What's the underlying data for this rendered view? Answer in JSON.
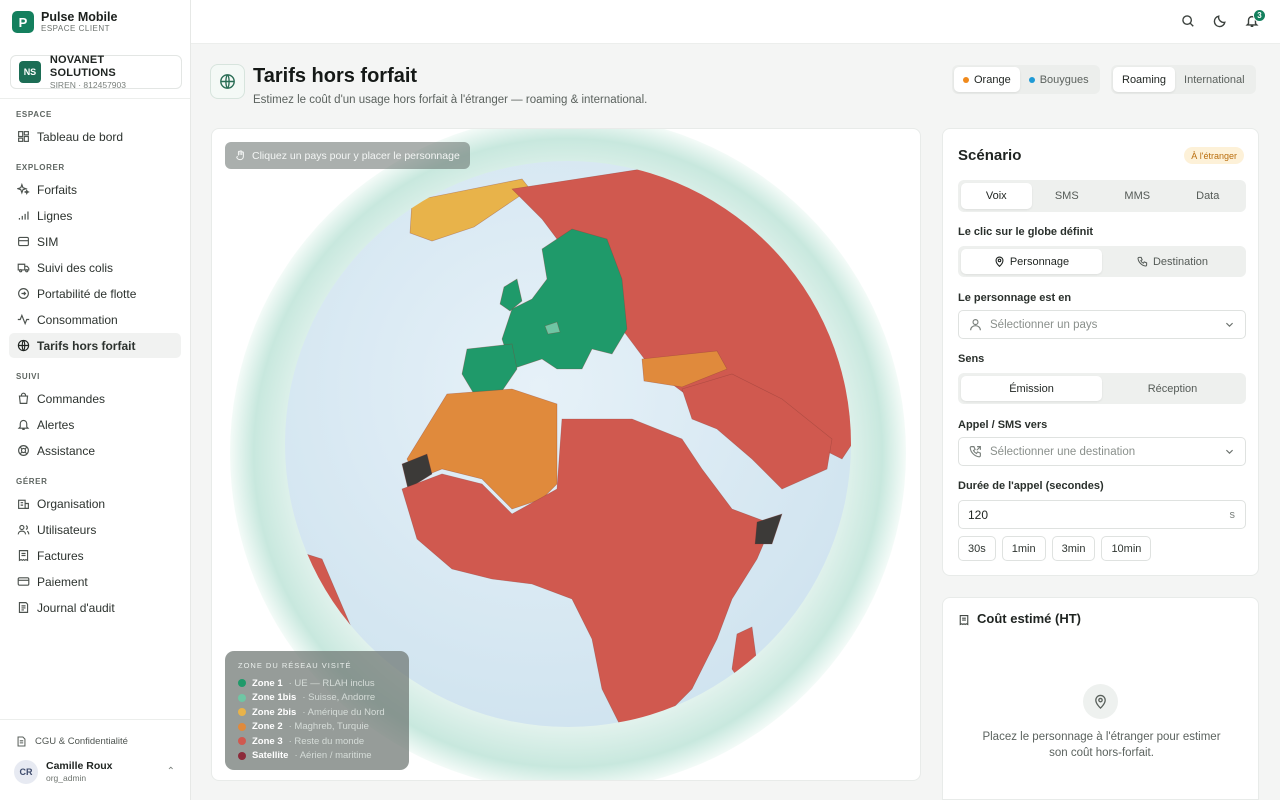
{
  "brand": {
    "logo_letter": "P",
    "name": "Pulse Mobile",
    "subtitle": "ESPACE CLIENT"
  },
  "org": {
    "initials": "NS",
    "name": "NOVANET SOLUTIONS",
    "siren": "SIREN · 812457903"
  },
  "nav": {
    "sections": [
      {
        "title": "ESPACE",
        "items": [
          {
            "label": "Tableau de bord",
            "icon": "dashboard-icon"
          }
        ]
      },
      {
        "title": "EXPLORER",
        "items": [
          {
            "label": "Forfaits",
            "icon": "sparkles-icon"
          },
          {
            "label": "Lignes",
            "icon": "signal-icon"
          },
          {
            "label": "SIM",
            "icon": "sim-card-icon"
          },
          {
            "label": "Suivi des colis",
            "icon": "truck-icon"
          },
          {
            "label": "Portabilité de flotte",
            "icon": "transfer-icon"
          },
          {
            "label": "Consommation",
            "icon": "activity-icon"
          },
          {
            "label": "Tarifs hors forfait",
            "icon": "globe-icon",
            "active": true
          }
        ]
      },
      {
        "title": "SUIVI",
        "items": [
          {
            "label": "Commandes",
            "icon": "shopping-bag-icon"
          },
          {
            "label": "Alertes",
            "icon": "bell-icon"
          },
          {
            "label": "Assistance",
            "icon": "lifebuoy-icon"
          }
        ]
      },
      {
        "title": "GÉRER",
        "items": [
          {
            "label": "Organisation",
            "icon": "building-icon"
          },
          {
            "label": "Utilisateurs",
            "icon": "users-icon"
          },
          {
            "label": "Factures",
            "icon": "receipt-icon"
          },
          {
            "label": "Paiement",
            "icon": "credit-card-icon"
          },
          {
            "label": "Journal d'audit",
            "icon": "audit-log-icon"
          }
        ]
      }
    ]
  },
  "footer": {
    "cgu": "CGU & Confidentialité",
    "user_initials": "CR",
    "user_name": "Camille Roux",
    "user_role": "org_admin"
  },
  "topbar": {
    "notif_count": "3"
  },
  "page": {
    "title": "Tarifs hors forfait",
    "subtitle": "Estimez le coût d'un usage hors forfait à l'étranger — roaming & international.",
    "operators": [
      {
        "label": "Orange",
        "color": "#f08a1c"
      },
      {
        "label": "Bouygues",
        "color": "#1e9ad6"
      }
    ],
    "modes": [
      "Roaming",
      "International"
    ]
  },
  "map": {
    "hint": "Cliquez un pays pour y placer le personnage",
    "legend_title": "ZONE DU RÉSEAU VISITÉ",
    "legend": [
      {
        "zone": "Zone 1",
        "desc": "· UE — RLAH inclus",
        "color": "#1f9a6a"
      },
      {
        "zone": "Zone 1bis",
        "desc": "· Suisse, Andorre",
        "color": "#6fc6a4"
      },
      {
        "zone": "Zone 2bis",
        "desc": "· Amérique du Nord",
        "color": "#e8b34a"
      },
      {
        "zone": "Zone 2",
        "desc": "· Maghreb, Turquie",
        "color": "#e08a3c"
      },
      {
        "zone": "Zone 3",
        "desc": "· Reste du monde",
        "color": "#d0594f"
      },
      {
        "zone": "Satellite",
        "desc": "· Aérien / maritime",
        "color": "#8c2a3a"
      }
    ]
  },
  "scenario": {
    "title": "Scénario",
    "badge": "À l'étranger",
    "tabs": [
      "Voix",
      "SMS",
      "MMS",
      "Data"
    ],
    "click_label": "Le clic sur le globe définit",
    "click_options": [
      "Personnage",
      "Destination"
    ],
    "location_label": "Le personnage est en",
    "location_placeholder": "Sélectionner un pays",
    "direction_label": "Sens",
    "direction_options": [
      "Émission",
      "Réception"
    ],
    "target_label": "Appel / SMS vers",
    "target_placeholder": "Sélectionner une destination",
    "duration_label": "Durée de l'appel (secondes)",
    "duration_value": "120",
    "duration_unit": "s",
    "presets": [
      "30s",
      "1min",
      "3min",
      "10min"
    ]
  },
  "cost": {
    "title": "Coût estimé (HT)",
    "message": "Placez le personnage à l'étranger pour estimer son coût hors-forfait."
  }
}
